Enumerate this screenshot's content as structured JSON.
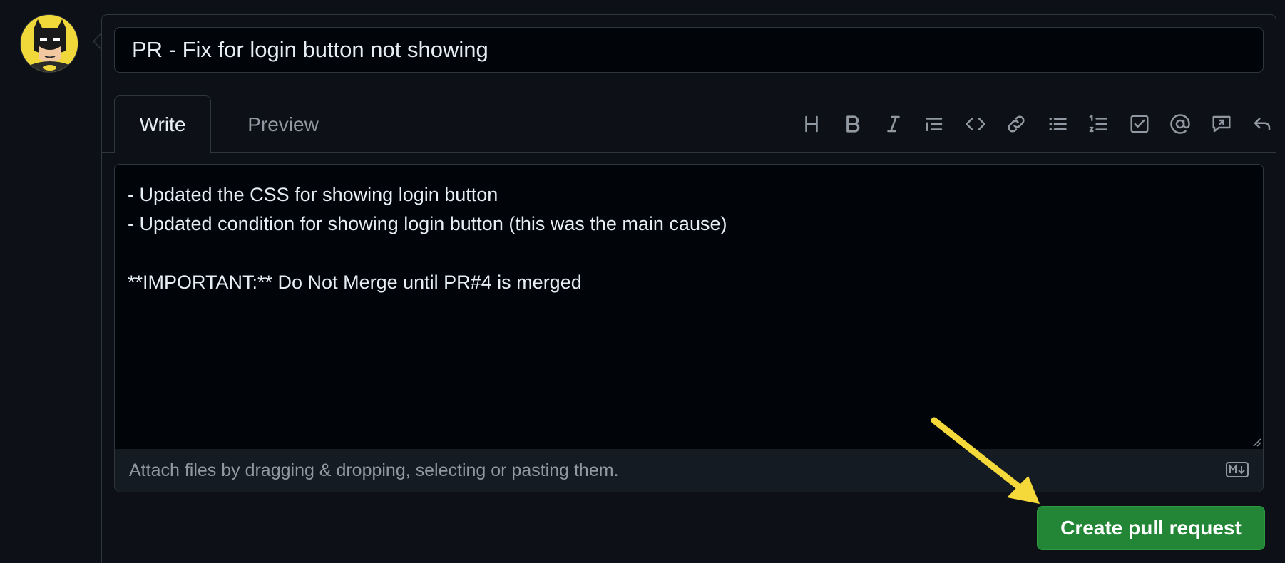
{
  "pr_form": {
    "title_value": "PR - Fix for login button not showing",
    "tabs": [
      {
        "label": "Write",
        "active": true
      },
      {
        "label": "Preview",
        "active": false
      }
    ],
    "toolbar_icons": [
      "heading-icon",
      "bold-icon",
      "italic-icon",
      "quote-icon",
      "code-icon",
      "link-icon",
      "unordered-list-icon",
      "ordered-list-icon",
      "task-list-icon",
      "mention-icon",
      "reference-icon",
      "undo-icon"
    ],
    "body_text": "- Updated the CSS for showing login button\n- Updated condition for showing login button (this was the main cause)\n\n**IMPORTANT:** Do Not Merge until PR#4 is merged",
    "attach_hint": "Attach files by dragging & dropping, selecting or pasting them.",
    "submit_label": "Create pull request"
  },
  "colors": {
    "background": "#0d1117",
    "input_bg": "#010409",
    "border": "#30363d",
    "primary_button": "#238636",
    "annotation_arrow": "#f5d93a"
  }
}
